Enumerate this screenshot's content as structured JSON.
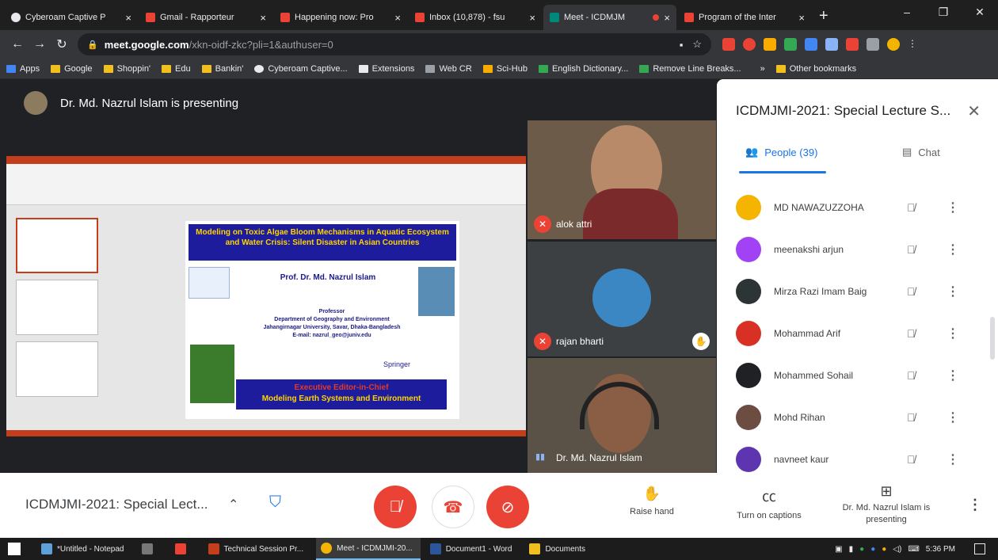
{
  "browser": {
    "tabs": [
      {
        "title": "Cyberoam Captive P",
        "favicon": "#e8eaed"
      },
      {
        "title": "Gmail - Rapporteur",
        "favicon": "#ea4335"
      },
      {
        "title": "Happening now: Pro",
        "favicon": "#ea4335"
      },
      {
        "title": "Inbox (10,878) - fsu",
        "favicon": "#ea4335"
      },
      {
        "title": "Meet - ICDMJM",
        "favicon": "#00897b",
        "active": true
      },
      {
        "title": "Program of the Inter",
        "favicon": "#ea4335"
      }
    ],
    "address": {
      "host": "meet.google.com",
      "path": "/xkn-oidf-zkc?pli=1&authuser=0"
    },
    "bookmarks": [
      "Apps",
      "Google",
      "Shoppin'",
      "Edu",
      "Bankin'",
      "Cyberoam Captive...",
      "Extensions",
      "Web CR",
      "Sci-Hub",
      "English Dictionary...",
      "Remove Line Breaks...",
      "Other bookmarks"
    ]
  },
  "meet": {
    "presenter_banner": "Dr. Md. Nazrul Islam is presenting",
    "slide": {
      "title": "Modeling on Toxic Algae Bloom Mechanisms in Aquatic Ecosystem and Water Crisis: Silent Disaster in Asian Countries",
      "prof": "Prof. Dr. Md. Nazrul Islam",
      "designation": "Professor",
      "dept": "Department of Geography and Environment",
      "univ": "Jahangirnagar University, Savar, Dhaka-Bangladesh",
      "email": "E-mail: nazrul_geo@juniv.edu",
      "springer": "Springer",
      "editor": "Executive Editor-in-Chief",
      "journal": "Modeling Earth Systems and Environment"
    },
    "tiles": [
      {
        "name": "alok attri"
      },
      {
        "name": "rajan bharti"
      },
      {
        "name": "Dr. Md. Nazrul Islam"
      }
    ],
    "panel": {
      "title": "ICDMJMI-2021: Special Lecture S...",
      "people_tab": "People (39)",
      "chat_tab": "Chat",
      "people": [
        {
          "name": "MD NAWAZUZZOHA",
          "color": "#f4b400"
        },
        {
          "name": "meenakshi arjun",
          "color": "#a142f4"
        },
        {
          "name": "Mirza Razi Imam Baig",
          "color": "#2d3436"
        },
        {
          "name": "Mohammad Arif",
          "color": "#d93025"
        },
        {
          "name": "Mohammed Sohail",
          "color": "#202124"
        },
        {
          "name": "Mohd Rihan",
          "color": "#6d4c41"
        },
        {
          "name": "navneet kaur",
          "color": "#5e35b1"
        }
      ]
    },
    "bottom": {
      "meeting_name": "ICDMJMI-2021: Special Lect...",
      "raise_hand": "Raise hand",
      "captions": "Turn on captions",
      "presenting": "Dr. Md. Nazrul Islam is presenting"
    }
  },
  "taskbar": {
    "items": [
      "*Untitled - Notepad",
      "",
      "",
      "Technical Session Pr...",
      "Meet - ICDMJMI-20...",
      "Document1 - Word",
      "Documents"
    ],
    "time": "5:36 PM"
  }
}
